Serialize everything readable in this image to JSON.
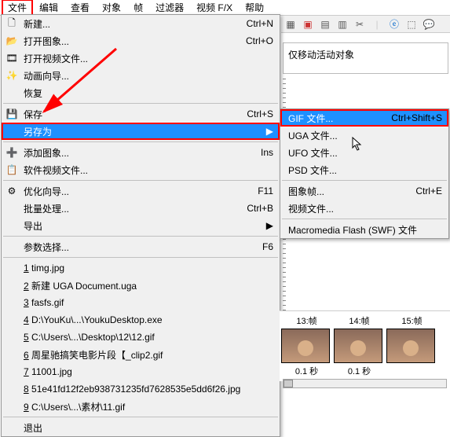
{
  "menubar": {
    "items": [
      "文件",
      "编辑",
      "查看",
      "对象",
      "帧",
      "过滤器",
      "视频 F/X",
      "帮助"
    ]
  },
  "menu": {
    "new": "新建...",
    "open_image": "打开图象...",
    "open_video": "打开视频文件...",
    "anim_wizard": "动画向导...",
    "restore": "恢复",
    "save": "保存",
    "save_as": "另存为",
    "add_image": "添加图象...",
    "soft_video": "软件视频文件...",
    "optimize": "优化向导...",
    "batch": "批量处理...",
    "export": "导出",
    "params": "参数选择...",
    "exit": "退出",
    "sc_new": "Ctrl+N",
    "sc_open": "Ctrl+O",
    "sc_save": "Ctrl+S",
    "sc_add": "Ins",
    "sc_opt": "F11",
    "sc_batch": "Ctrl+B",
    "sc_params": "F6"
  },
  "recent": [
    {
      "n": "1",
      "name": "timg.jpg"
    },
    {
      "n": "2",
      "name": "新建 UGA Document.uga"
    },
    {
      "n": "3",
      "name": "fasfs.gif"
    },
    {
      "n": "4",
      "name": "D:\\YouKu\\...\\YoukuDesktop.exe"
    },
    {
      "n": "5",
      "name": "C:\\Users\\...\\Desktop\\12\\12.gif"
    },
    {
      "n": "6",
      "name": "周星驰搞笑电影片段【_clip2.gif"
    },
    {
      "n": "7",
      "name": "11001.jpg"
    },
    {
      "n": "8",
      "name": "51e41fd12f2eb938731235fd7628535e5dd6f26.jpg"
    },
    {
      "n": "9",
      "name": "C:\\Users\\...\\素材\\11.gif"
    }
  ],
  "submenu": {
    "gif": "GIF 文件...",
    "gif_sc": "Ctrl+Shift+S",
    "uga": "UGA 文件...",
    "ufo": "UFO 文件...",
    "psd": "PSD 文件...",
    "image_frame": "图象帧...",
    "image_frame_sc": "Ctrl+E",
    "video": "视频文件...",
    "swf": "Macromedia Flash (SWF) 文件"
  },
  "status": "仅移动活动对象",
  "frames": [
    {
      "label": "13:帧",
      "dur": "0.1 秒"
    },
    {
      "label": "14:帧",
      "dur": "0.1 秒"
    },
    {
      "label": "15:帧",
      "dur": ""
    }
  ]
}
